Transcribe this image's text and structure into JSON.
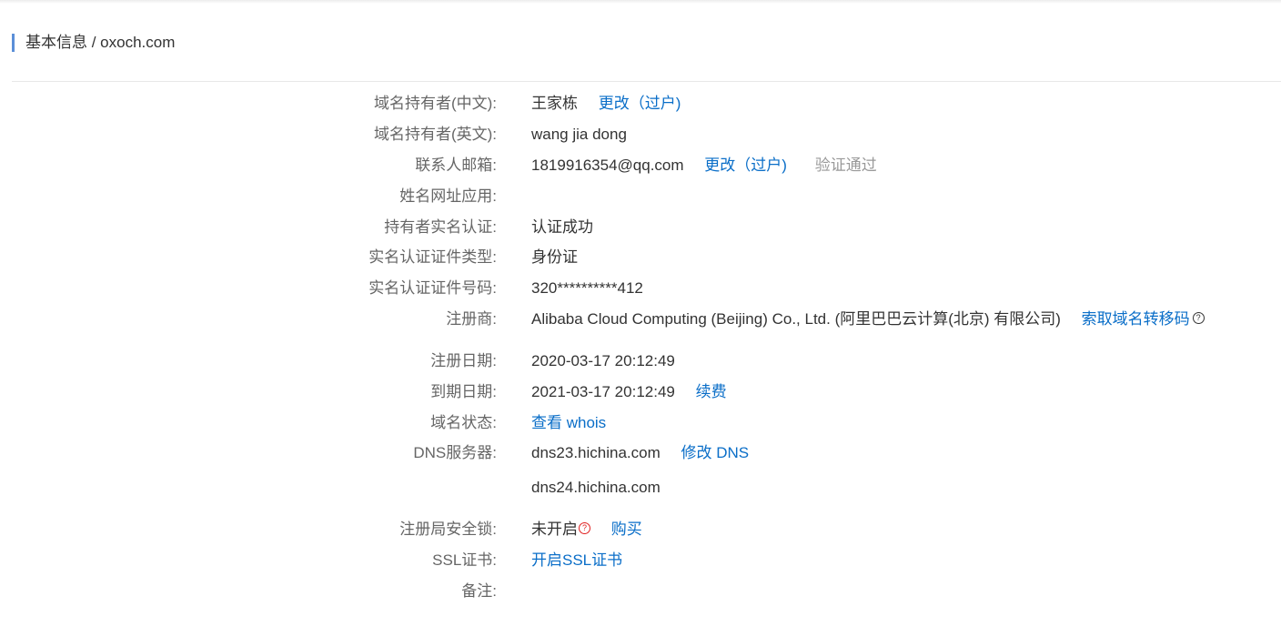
{
  "header": {
    "title": "基本信息 / oxoch.com"
  },
  "fields": {
    "owner_cn": {
      "label": "域名持有者(中文):",
      "value": "王家栋",
      "action": "更改（过户)"
    },
    "owner_en": {
      "label": "域名持有者(英文):",
      "value": "wang jia dong"
    },
    "email": {
      "label": "联系人邮箱:",
      "value": "1819916354@qq.com",
      "action": "更改（过户)",
      "status": "验证通过"
    },
    "name_site": {
      "label": "姓名网址应用:",
      "value": ""
    },
    "realname": {
      "label": "持有者实名认证:",
      "value": "认证成功"
    },
    "cert_type": {
      "label": "实名认证证件类型:",
      "value": "身份证"
    },
    "cert_no": {
      "label": "实名认证证件号码:",
      "value": "320**********412"
    },
    "registrar": {
      "label": "注册商:",
      "value": "Alibaba Cloud Computing (Beijing) Co., Ltd. (阿里巴巴云计算(北京) 有限公司)",
      "action": "索取域名转移码"
    },
    "reg_date": {
      "label": "注册日期:",
      "value": "2020-03-17 20:12:49"
    },
    "exp_date": {
      "label": "到期日期:",
      "value": "2021-03-17 20:12:49",
      "action": "续费"
    },
    "status": {
      "label": "域名状态:",
      "action": "查看 whois"
    },
    "dns": {
      "label": "DNS服务器:",
      "value": "dns23.hichina.com",
      "value2": "dns24.hichina.com",
      "action": "修改 DNS"
    },
    "lock": {
      "label": "注册局安全锁:",
      "value": "未开启",
      "action": "购买"
    },
    "ssl": {
      "label": "SSL证书:",
      "action": "开启SSL证书"
    },
    "remark": {
      "label": "备注:",
      "value": ""
    }
  },
  "icons": {
    "help": "question-circle-icon",
    "help_alert": "question-circle-red-icon"
  },
  "colors": {
    "link": "#0a6ec8",
    "label": "#666666",
    "muted": "#999999",
    "accent_bar": "#5b8fd8",
    "alert": "#e02020"
  }
}
